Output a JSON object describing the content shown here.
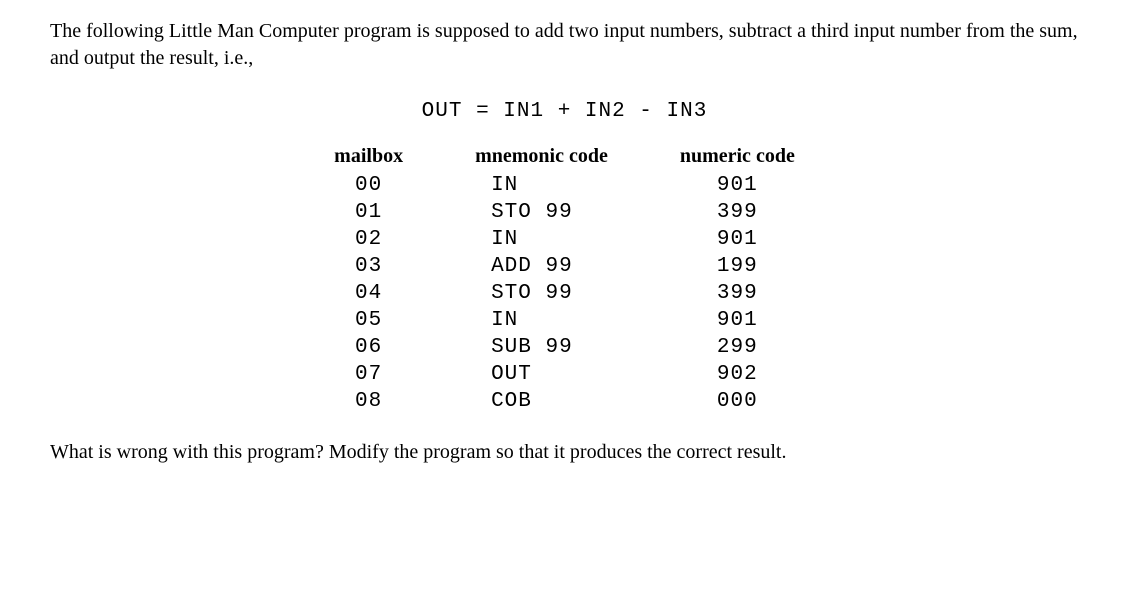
{
  "intro": "The following Little Man Computer program is supposed to add two input numbers, subtract a third input number from the sum, and output the result, i.e.,",
  "formula": "OUT = IN1 + IN2 - IN3",
  "headers": {
    "mailbox": "mailbox",
    "mnemonic": "mnemonic code",
    "numeric": "numeric code"
  },
  "rows": [
    {
      "mailbox": "00",
      "mnemonic": "IN",
      "numeric": "901"
    },
    {
      "mailbox": "01",
      "mnemonic": "STO 99",
      "numeric": "399"
    },
    {
      "mailbox": "02",
      "mnemonic": "IN",
      "numeric": "901"
    },
    {
      "mailbox": "03",
      "mnemonic": "ADD 99",
      "numeric": "199"
    },
    {
      "mailbox": "04",
      "mnemonic": "STO 99",
      "numeric": "399"
    },
    {
      "mailbox": "05",
      "mnemonic": "IN",
      "numeric": "901"
    },
    {
      "mailbox": "06",
      "mnemonic": "SUB 99",
      "numeric": "299"
    },
    {
      "mailbox": "07",
      "mnemonic": "OUT",
      "numeric": "902"
    },
    {
      "mailbox": "08",
      "mnemonic": "COB",
      "numeric": "000"
    }
  ],
  "outro": "What is wrong with this program? Modify the program so that it produces the correct result."
}
